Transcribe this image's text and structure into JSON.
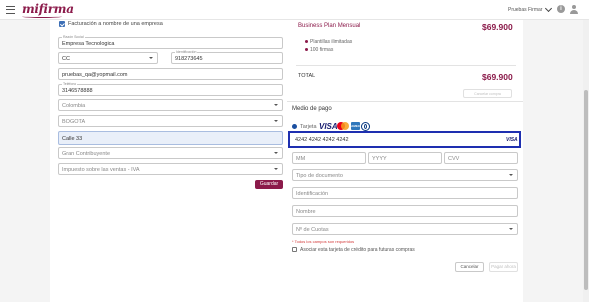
{
  "header": {
    "logo_text": "mifirma",
    "account_name": "Pruebas Firmar",
    "icons": [
      "menu-icon",
      "chevron-down-icon",
      "info-icon",
      "user-icon"
    ]
  },
  "billing_form": {
    "invoice_checkbox_label": "Facturación a nombre de una empresa",
    "invoice_checkbox_checked": true,
    "company_name": {
      "label": "Razón Social",
      "value": "Empresa Tecnologica"
    },
    "id_type": {
      "value": "CC"
    },
    "id_number": {
      "label": "Identificación",
      "value": "918273645"
    },
    "email": {
      "label": "",
      "value": "pruebas_qa@yopmail.com"
    },
    "phone": {
      "label": "Teléfono",
      "value": "3146578888"
    },
    "country": {
      "value": "Colombia"
    },
    "city": {
      "value": "BOGOTA"
    },
    "address": {
      "value": "Calle 33"
    },
    "taxpayer_type": {
      "placeholder": "Gran Contribuyente"
    },
    "sales_tax": {
      "placeholder": "Impuesto sobre las ventas - IVA"
    },
    "save_button": "Guardar"
  },
  "summary": {
    "plan_name": "Business Plan Mensual",
    "plan_price": "$69.900",
    "features": [
      "Plantillas ilimitadas",
      "100 firmas"
    ],
    "total_label": "TOTAL",
    "total_value": "$69.900",
    "faded_button": "Cancelar compra"
  },
  "payment": {
    "section_title": "Medio de pago",
    "method_label": "Tarjeta",
    "brands": [
      "VISA",
      "Mastercard",
      "American Express",
      "Diners Club"
    ],
    "card_number": "4242 4242 4242 4242",
    "detected_brand": "VISA",
    "month_placeholder": "MM",
    "year_placeholder": "YYYY",
    "cvv_placeholder": "CVV",
    "doc_type_placeholder": "Tipo de documento",
    "id_placeholder": "Identificación",
    "name_placeholder": "Nombre",
    "installments_placeholder": "Nº de Cuotas",
    "required_note": "* Todos los campos son requeridos",
    "save_card_label": "Asociar esta tarjeta de crédito para futuras compras",
    "cancel_button": "Cancelar",
    "pay_button": "Pagar ahora"
  },
  "colors": {
    "brand": "#8b1a4a",
    "focus_border": "#1e2fb0",
    "checkbox": "#3d6fb6",
    "required_text": "#d33a3a"
  }
}
